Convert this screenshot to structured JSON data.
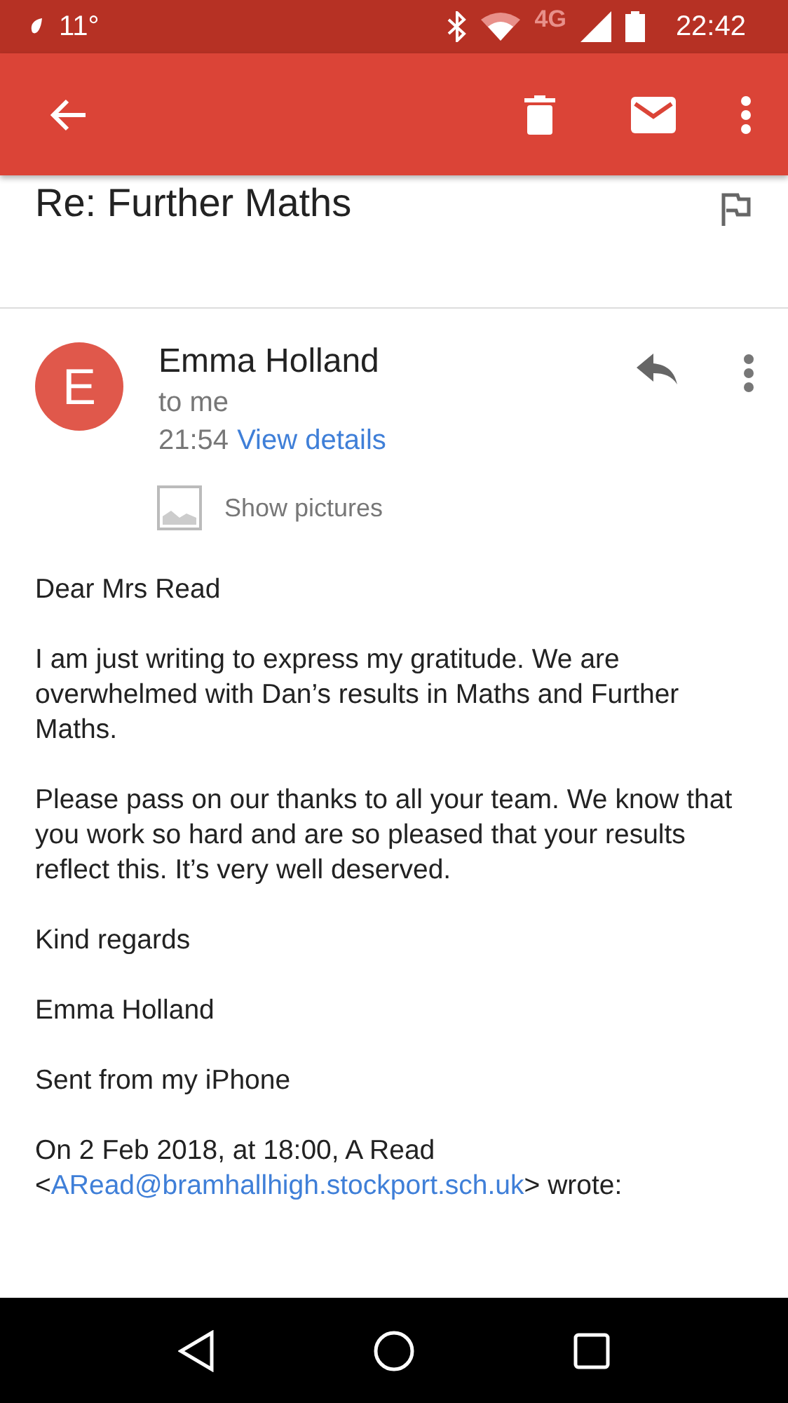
{
  "status_bar": {
    "temperature": "11°",
    "network": "4G",
    "time": "22:42"
  },
  "subject": "Re: Further Maths",
  "sender": {
    "initial": "E",
    "name": "Emma Holland",
    "recipient": "to me",
    "time": "21:54",
    "details_link": "View details"
  },
  "show_pictures": "Show pictures",
  "body": [
    "Dear Mrs Read",
    "I am just writing to express my gratitude. We are overwhelmed with Dan’s results in Maths and Further Maths.",
    "Please pass on our thanks to all your team. We know that you work so hard and are so pleased that your results reflect this. It’s very well deserved.",
    "Kind regards",
    "Emma Holland",
    "Sent from my iPhone"
  ],
  "quote": {
    "line": "On 2 Feb 2018, at 18:00, A Read",
    "prefix": "<",
    "email": "ARead@bramhallhigh.stockport.sch.uk",
    "suffix": "> wrote:"
  }
}
